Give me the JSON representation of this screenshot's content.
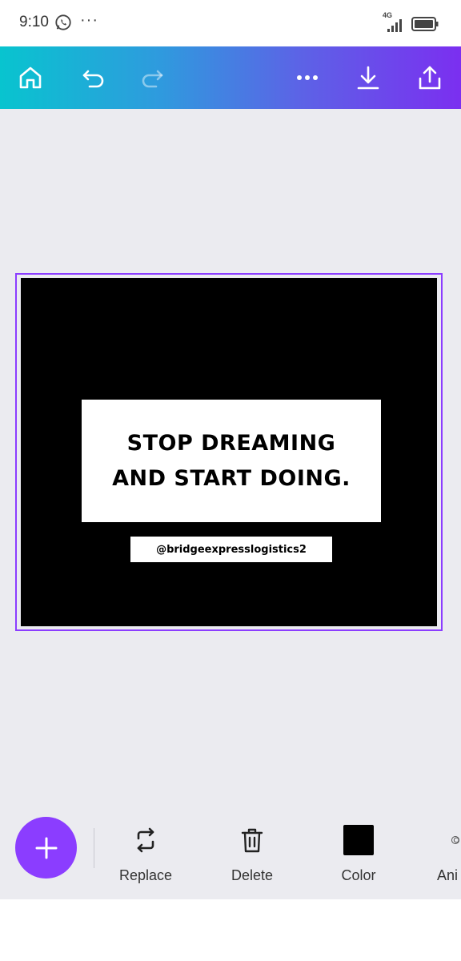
{
  "status_bar": {
    "time": "9:10",
    "dots": "···",
    "network": "4G",
    "icons": [
      "whatsapp-icon",
      "signal-icon",
      "battery-icon"
    ]
  },
  "toolbar": {
    "gradient": [
      "#08c4cf",
      "#7b2ff0"
    ],
    "buttons": [
      "home-icon",
      "undo-icon",
      "redo-icon",
      "more-icon",
      "download-icon",
      "share-icon"
    ]
  },
  "design": {
    "selection_color": "#8b3dff",
    "background_color": "#000000",
    "quote_line_1": "STOP DREAMING",
    "quote_line_2": "AND START DOING.",
    "handle": "@bridgeexpresslogistics2"
  },
  "bottom_toolbar": {
    "add_icon": "plus-icon",
    "tools": [
      {
        "label": "Replace",
        "icon": "replace-icon"
      },
      {
        "label": "Delete",
        "icon": "trash-icon"
      },
      {
        "label": "Color",
        "icon": "color-swatch",
        "swatch": "#000000"
      },
      {
        "label": "Ani",
        "icon": "animate-icon"
      }
    ]
  }
}
